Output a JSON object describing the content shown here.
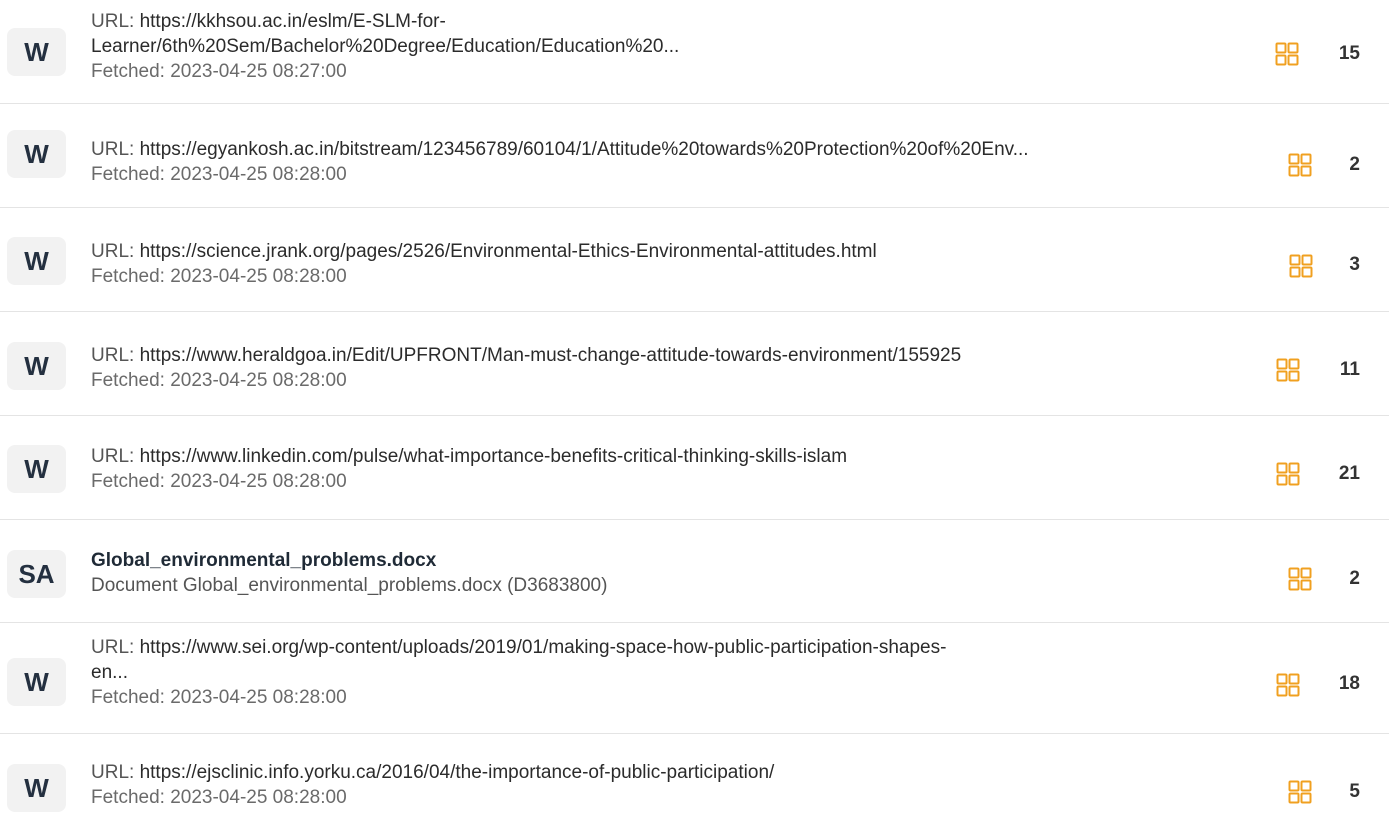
{
  "sources": [
    {
      "badge": "W",
      "url_prefix": "URL: ",
      "url_line1": "https://kkhsou.ac.in/eslm/E-SLM-for-",
      "url_line2": "Learner/6th%20Sem/Bachelor%20Degree/Education/Education%20...",
      "fetched": "Fetched: 2023-04-25 08:27:00",
      "count": "15"
    },
    {
      "badge": "W",
      "url_prefix": "URL: ",
      "url_line1": "https://egyankosh.ac.in/bitstream/123456789/60104/1/Attitude%20towards%20Protection%20of%20Env...",
      "fetched": "Fetched: 2023-04-25 08:28:00",
      "count": "2"
    },
    {
      "badge": "W",
      "url_prefix": "URL: ",
      "url_line1": "https://science.jrank.org/pages/2526/Environmental-Ethics-Environmental-attitudes.html",
      "fetched": "Fetched: 2023-04-25 08:28:00",
      "count": "3"
    },
    {
      "badge": "W",
      "url_prefix": "URL: ",
      "url_line1": "https://www.heraldgoa.in/Edit/UPFRONT/Man-must-change-attitude-towards-environment/155925",
      "fetched": "Fetched: 2023-04-25 08:28:00",
      "count": "11"
    },
    {
      "badge": "W",
      "url_prefix": "URL: ",
      "url_line1": "https://www.linkedin.com/pulse/what-importance-benefits-critical-thinking-skills-islam",
      "fetched": "Fetched: 2023-04-25 08:28:00",
      "count": "21"
    },
    {
      "badge": "SA",
      "title": "Global_environmental_problems.docx",
      "subtitle": "Document Global_environmental_problems.docx (D3683800)",
      "count": "2"
    },
    {
      "badge": "W",
      "url_prefix": "URL: ",
      "url_line1": "https://www.sei.org/wp-content/uploads/2019/01/making-space-how-public-participation-shapes-",
      "url_line2": "en...",
      "fetched": "Fetched: 2023-04-25 08:28:00",
      "count": "18"
    },
    {
      "badge": "W",
      "url_prefix": "URL: ",
      "url_line1": "https://ejsclinic.info.yorku.ca/2016/04/the-importance-of-public-participation/",
      "fetched": "Fetched: 2023-04-25 08:28:00",
      "count": "5"
    }
  ],
  "icons": {
    "match_icon": "grid-four-squares-icon",
    "match_icon_color": "#f0a020"
  }
}
